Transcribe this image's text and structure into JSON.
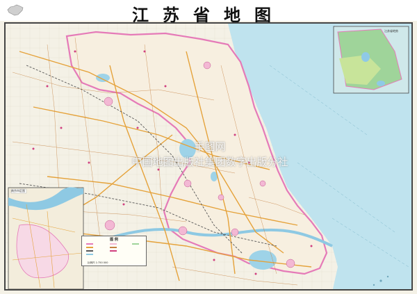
{
  "map": {
    "title": "江苏省地图",
    "watermark_line1": "手图网",
    "watermark_line2": "中国地图出版社集团数字出版分社",
    "inset_top_right_label": "江苏省地势",
    "inset_bottom_left_label": "南京市区图",
    "legend_title": "图  例",
    "legend_scale": "比例尺 1:750 000",
    "colors": {
      "land": "#f4f1e6",
      "sea": "#bfe3ee",
      "lake": "#9ed3e8",
      "province_border": "#e57ab8",
      "road_major": "#e5a23a",
      "road_minor": "#c48040",
      "rail": "#555555",
      "frame": "#444444",
      "city_fill": "#f3b8d4"
    },
    "icons": [
      "china-outline-icon"
    ]
  }
}
